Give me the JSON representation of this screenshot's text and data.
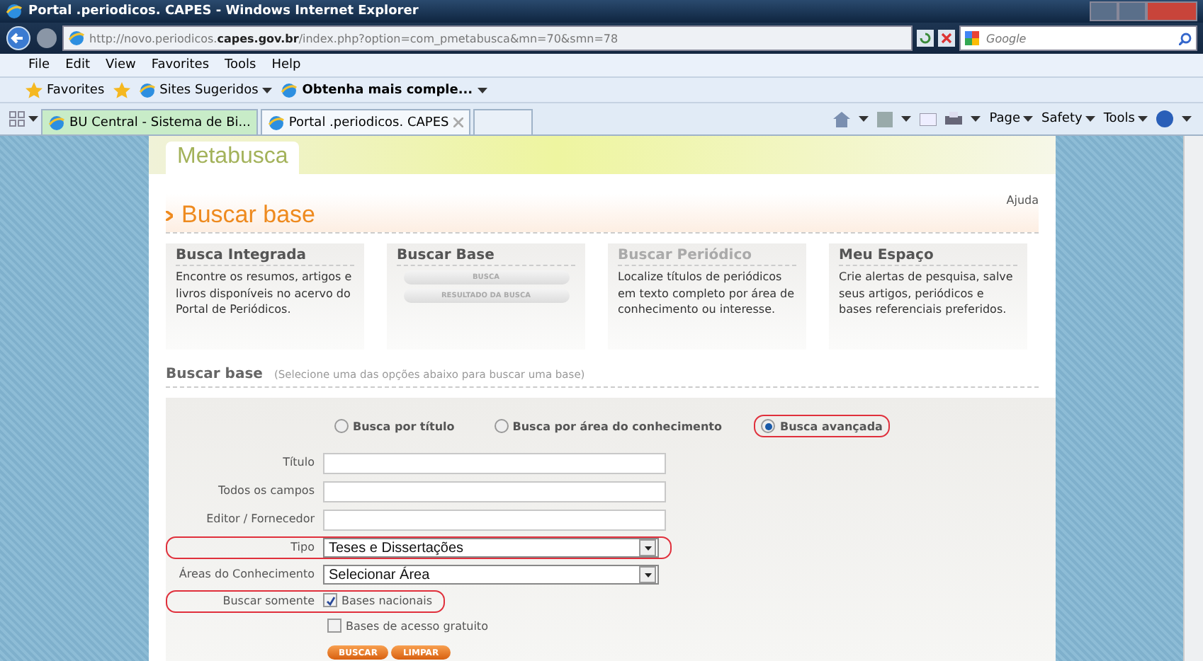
{
  "window": {
    "title": "Portal .periodicos. CAPES - Windows Internet Explorer"
  },
  "address_bar": {
    "url_start": "http://novo.periodicos.",
    "url_domain": "capes.gov.br",
    "url_end": "/index.php?option=com_pmetabusca&mn=70&smn=78"
  },
  "search": {
    "placeholder": "Google"
  },
  "menu": [
    "File",
    "Edit",
    "View",
    "Favorites",
    "Tools",
    "Help"
  ],
  "favorites_bar": {
    "label": "Favorites",
    "links": [
      "Sites Sugeridos",
      "Obtenha mais comple..."
    ]
  },
  "tabs": [
    {
      "label": "BU Central - Sistema de Bi...",
      "selected": false
    },
    {
      "label": "Portal .periodicos. CAPES",
      "selected": true
    }
  ],
  "command_bar": [
    "Page",
    "Safety",
    "Tools"
  ],
  "page": {
    "header_tab": "Metabusca",
    "heading": "Buscar base",
    "help_link": "Ajuda",
    "cards": [
      {
        "kind": "text",
        "title": "Busca Integrada",
        "disabled": false,
        "text": "Encontre os resumos, artigos e livros disponíveis no acervo do Portal de Periódicos."
      },
      {
        "kind": "buttons",
        "title": "Buscar Base",
        "disabled": false,
        "buttons": [
          "BUSCA",
          "RESULTADO DA BUSCA"
        ]
      },
      {
        "kind": "text",
        "title": "Buscar Periódico",
        "disabled": true,
        "text": "Localize títulos de periódicos em texto completo por área de conhecimento ou interesse."
      },
      {
        "kind": "text",
        "title": "Meu Espaço",
        "disabled": false,
        "text": "Crie alertas de pesquisa, salve seus artigos, periódicos e bases referenciais preferidos."
      }
    ],
    "section": {
      "title": "Buscar base",
      "hint": "(Selecione uma das opções abaixo para buscar uma base)"
    },
    "search_modes": [
      {
        "label": "Busca por título",
        "selected": false,
        "highlighted": false
      },
      {
        "label": "Busca por área do conhecimento",
        "selected": false,
        "highlighted": false
      },
      {
        "label": "Busca avançada",
        "selected": true,
        "highlighted": true
      }
    ],
    "fields": [
      {
        "kind": "text",
        "label": "Título",
        "highlighted": false
      },
      {
        "kind": "text",
        "label": "Todos os campos",
        "highlighted": false
      },
      {
        "kind": "text",
        "label": "Editor / Fornecedor",
        "highlighted": false
      },
      {
        "kind": "select",
        "label": "Tipo",
        "value": "Teses e Dissertações",
        "highlighted": true
      },
      {
        "kind": "select",
        "label": "Áreas do Conhecimento",
        "value": "Selecionar Área",
        "highlighted": false
      },
      {
        "kind": "checks",
        "label": "Buscar somente",
        "highlighted": true,
        "options": [
          {
            "label": "Bases nacionais",
            "checked": true
          },
          {
            "label": "Bases de acesso gratuito",
            "checked": false
          }
        ]
      }
    ],
    "buttons": [
      "BUSCAR",
      "LIMPAR"
    ]
  }
}
